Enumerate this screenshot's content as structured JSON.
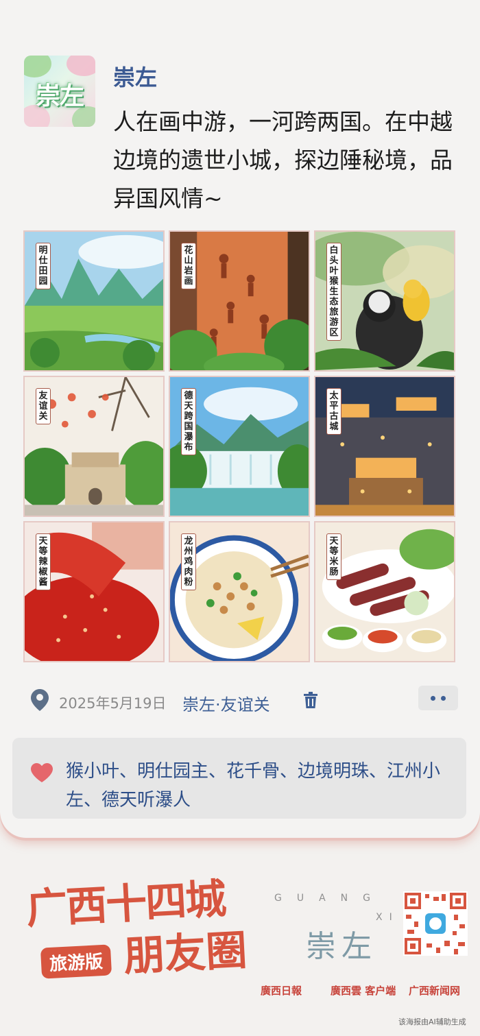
{
  "post": {
    "avatar_text": "崇左",
    "name": "崇左",
    "text": "人在画中游，一河跨两国。在中越边境的遗世小城，探边陲秘境，品异国风情~"
  },
  "images": [
    {
      "label": "明仕田园",
      "scene": "karst-fields"
    },
    {
      "label": "花山岩画",
      "scene": "rock-paintings"
    },
    {
      "label": "白头叶猴生态旅游区",
      "scene": "monkeys"
    },
    {
      "label": "友谊关",
      "scene": "pass-gate"
    },
    {
      "label": "德天跨国瀑布",
      "scene": "waterfall"
    },
    {
      "label": "太平古城",
      "scene": "ancient-city-night"
    },
    {
      "label": "天等辣椒酱",
      "scene": "chili-sauce"
    },
    {
      "label": "龙州鸡肉粉",
      "scene": "noodle-bowl"
    },
    {
      "label": "天等米肠",
      "scene": "rice-sausage"
    }
  ],
  "meta": {
    "date": "2025年5月19日",
    "location": "崇左·友谊关",
    "icons": {
      "location": "map-pin-icon",
      "delete": "trash-icon",
      "more": "more-dots-icon"
    },
    "accent": "#3e5f95"
  },
  "likes": {
    "names": "猴小叶、明仕园主、花千骨、边境明珠、江州小左、德天听瀑人",
    "heart_color": "#e5666b"
  },
  "footer": {
    "title_line1": "广西十四城",
    "title_line2": "朋友圈",
    "badge": "旅游版",
    "guang": "GUANG",
    "xi": "XI",
    "city": "崇左",
    "logo1": "廣西日報",
    "logo2": "廣西雲 客户端",
    "logo3": "广西新闻网",
    "ai_note": "该海报由AI辅助生成",
    "brand_color": "#d7553f"
  }
}
